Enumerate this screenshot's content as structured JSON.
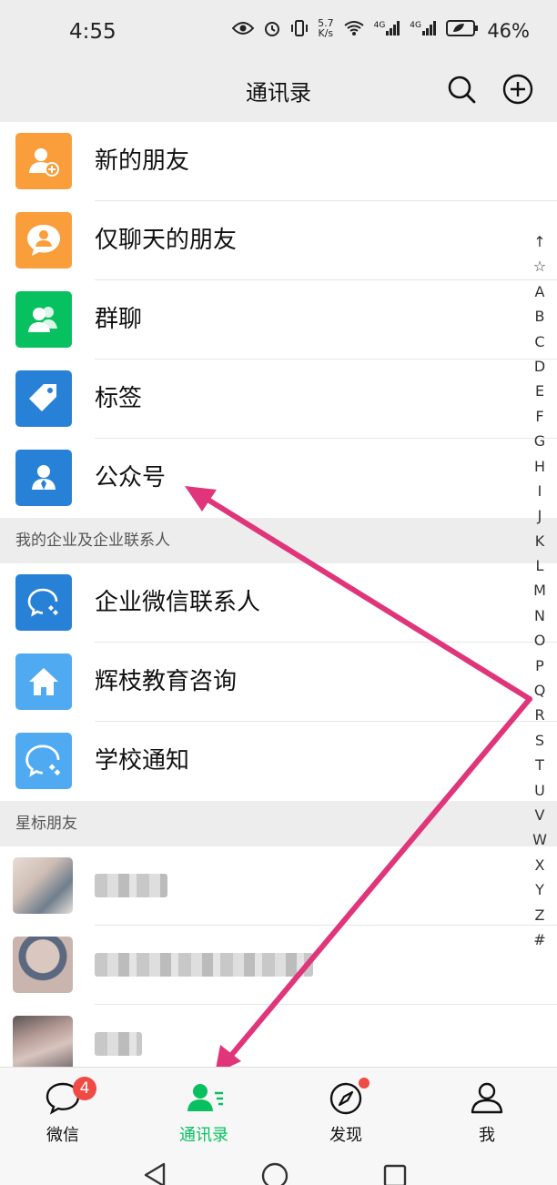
{
  "status_bar": {
    "time": "4:55",
    "net_speed_value": "5.7",
    "net_speed_unit": "K/s",
    "signal_1": "4G",
    "signal_2": "4G",
    "battery": "46%"
  },
  "header": {
    "title": "通讯录",
    "search_icon": "search-icon",
    "add_icon": "plus-circle-icon"
  },
  "menu": [
    {
      "label": "新的朋友",
      "color": "#fa9d3b",
      "icon": "add-friend-icon"
    },
    {
      "label": "仅聊天的朋友",
      "color": "#fa9d3b",
      "icon": "chat-only-friend-icon"
    },
    {
      "label": "群聊",
      "color": "#07c160",
      "icon": "group-chat-icon"
    },
    {
      "label": "标签",
      "color": "#2782d7",
      "icon": "tag-icon"
    },
    {
      "label": "公众号",
      "color": "#2782d7",
      "icon": "official-account-icon"
    }
  ],
  "sections": {
    "enterprise": "我的企业及企业联系人",
    "starred": "星标朋友"
  },
  "enterprise_items": [
    {
      "label": "企业微信联系人",
      "color": "#2782d7",
      "icon": "wecom-icon"
    },
    {
      "label": "辉枝教育咨询",
      "color": "#4faaf2",
      "icon": "home-icon"
    },
    {
      "label": "学校通知",
      "color": "#4faaf2",
      "icon": "wecom-icon"
    }
  ],
  "index_letters": [
    "↑",
    "☆",
    "A",
    "B",
    "C",
    "D",
    "E",
    "F",
    "G",
    "H",
    "I",
    "J",
    "K",
    "L",
    "M",
    "N",
    "O",
    "P",
    "Q",
    "R",
    "S",
    "T",
    "U",
    "V",
    "W",
    "X",
    "Y",
    "Z",
    "#"
  ],
  "tabs": [
    {
      "label": "微信",
      "icon": "chat-bubble-icon",
      "badge": "4"
    },
    {
      "label": "通讯录",
      "icon": "contacts-icon",
      "active": true
    },
    {
      "label": "发现",
      "icon": "compass-icon"
    },
    {
      "label": "我",
      "icon": "person-icon"
    }
  ],
  "colors": {
    "accent": "#07c160",
    "badge": "#f04a45",
    "arrow": "#e0357a"
  }
}
